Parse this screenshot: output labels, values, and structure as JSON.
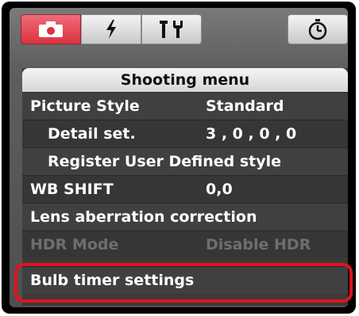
{
  "tabs": [
    {
      "icon": "camera-icon",
      "active": true
    },
    {
      "icon": "flash-icon",
      "active": false
    },
    {
      "icon": "tools-icon",
      "active": false
    },
    {
      "icon": "timer-icon",
      "active": false
    }
  ],
  "menu": {
    "header": "Shooting menu",
    "items": [
      {
        "label": "Picture Style",
        "value": "Standard",
        "indent": false,
        "enabled": true
      },
      {
        "label": "Detail set.",
        "value": "3 , 0 , 0 , 0",
        "indent": true,
        "enabled": true
      },
      {
        "label": "Register User Defined style",
        "value": "",
        "indent": true,
        "enabled": true
      },
      {
        "label": "WB SHIFT",
        "value": "0,0",
        "indent": false,
        "enabled": true
      },
      {
        "label": "Lens aberration correction",
        "value": "",
        "indent": false,
        "enabled": true
      },
      {
        "label": "HDR Mode",
        "value": "Disable HDR",
        "indent": false,
        "enabled": false
      },
      {
        "label": "Bulb timer settings",
        "value": "",
        "indent": false,
        "enabled": true,
        "highlighted": true
      }
    ]
  },
  "colors": {
    "active_tab": "#e23a48",
    "highlight_border": "#e3121f",
    "disabled_text": "#6e6e6e"
  }
}
